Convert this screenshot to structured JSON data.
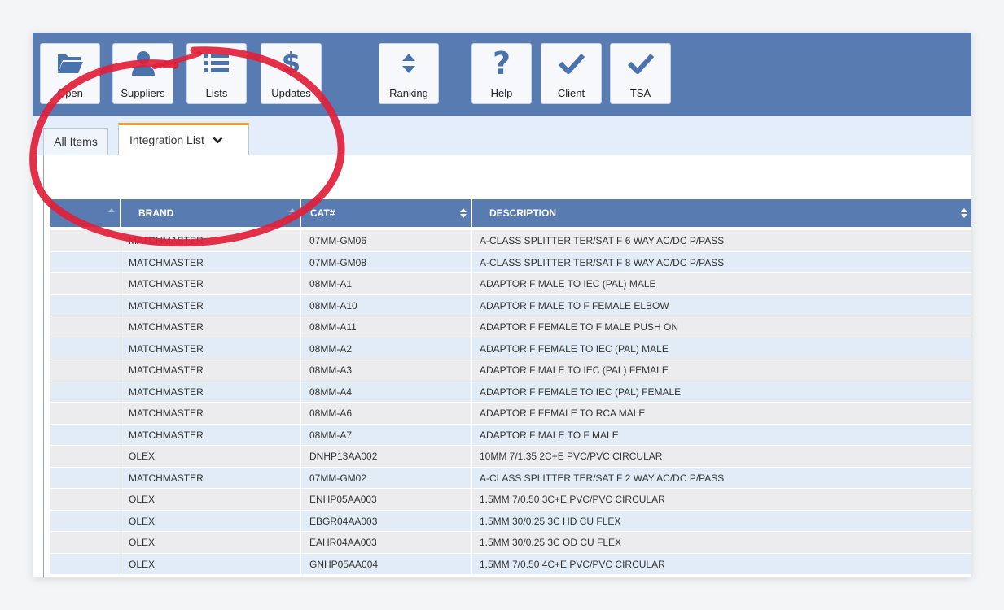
{
  "toolbar": {
    "buttons": [
      {
        "label": "Open",
        "icon": "folder-icon"
      },
      {
        "label": "Suppliers",
        "icon": "user-icon"
      },
      {
        "label": "Lists",
        "icon": "list-icon"
      },
      {
        "label": "Updates",
        "icon": "dollar-icon"
      },
      {
        "label": "Ranking",
        "icon": "sort-icon"
      },
      {
        "label": "Help",
        "icon": "question-icon"
      },
      {
        "label": "Client",
        "icon": "check-icon"
      },
      {
        "label": "TSA",
        "icon": "check-icon"
      }
    ]
  },
  "tabs": {
    "all_items": "All Items",
    "integration_list": "Integration List"
  },
  "table": {
    "headers": [
      "",
      "BRAND",
      "CAT#",
      "DESCRIPTION"
    ],
    "rows": [
      [
        "MATCHMASTER",
        "07MM-GM06",
        "A-CLASS SPLITTER TER/SAT F 6 WAY AC/DC P/PASS"
      ],
      [
        "MATCHMASTER",
        "07MM-GM08",
        "A-CLASS SPLITTER TER/SAT F 8 WAY AC/DC P/PASS"
      ],
      [
        "MATCHMASTER",
        "08MM-A1",
        "ADAPTOR F MALE TO IEC (PAL) MALE"
      ],
      [
        "MATCHMASTER",
        "08MM-A10",
        "ADAPTOR F MALE TO F FEMALE ELBOW"
      ],
      [
        "MATCHMASTER",
        "08MM-A11",
        "ADAPTOR F FEMALE TO F MALE PUSH ON"
      ],
      [
        "MATCHMASTER",
        "08MM-A2",
        "ADAPTOR F FEMALE TO IEC (PAL) MALE"
      ],
      [
        "MATCHMASTER",
        "08MM-A3",
        "ADAPTOR F MALE TO IEC (PAL) FEMALE"
      ],
      [
        "MATCHMASTER",
        "08MM-A4",
        "ADAPTOR F FEMALE TO IEC (PAL) FEMALE"
      ],
      [
        "MATCHMASTER",
        "08MM-A6",
        "ADAPTOR F FEMALE TO RCA MALE"
      ],
      [
        "MATCHMASTER",
        "08MM-A7",
        "ADAPTOR F MALE TO F MALE"
      ],
      [
        "OLEX",
        "DNHP13AA002",
        "10MM 7/1.35 2C+E PVC/PVC CIRCULAR"
      ],
      [
        "MATCHMASTER",
        "07MM-GM02",
        "A-CLASS SPLITTER TER/SAT F 2 WAY AC/DC P/PASS"
      ],
      [
        "OLEX",
        "ENHP05AA003",
        "1.5MM 7/0.50 3C+E PVC/PVC CIRCULAR"
      ],
      [
        "OLEX",
        "EBGR04AA003",
        "1.5MM 30/0.25 3C HD CU FLEX"
      ],
      [
        "OLEX",
        "EAHR04AA003",
        "1.5MM 30/0.25 3C OD CU FLEX"
      ],
      [
        "OLEX",
        "GNHP05AA004",
        "1.5MM 7/0.50 4C+E PVC/PVC CIRCULAR"
      ]
    ]
  },
  "colors": {
    "toolbar": "#587cb2",
    "header": "#587cb2",
    "tab_accent": "#f0a030",
    "annotation": "#e0203a"
  }
}
